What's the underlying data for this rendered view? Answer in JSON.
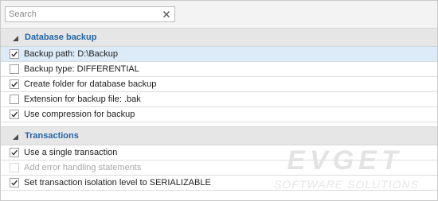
{
  "search": {
    "placeholder": "Search",
    "value": "",
    "clear_icon": "close-icon"
  },
  "groups": [
    {
      "title": "Database backup",
      "expanded": true,
      "items": [
        {
          "label": "Backup path: D:\\Backup",
          "checked": true,
          "enabled": true,
          "selected": true
        },
        {
          "label": "Backup type: DIFFERENTIAL",
          "checked": false,
          "enabled": true,
          "selected": false
        },
        {
          "label": "Create folder for database backup",
          "checked": true,
          "enabled": true,
          "selected": false
        },
        {
          "label": "Extension for backup file: .bak",
          "checked": false,
          "enabled": true,
          "selected": false
        },
        {
          "label": "Use compression for backup",
          "checked": true,
          "enabled": true,
          "selected": false
        }
      ]
    },
    {
      "title": "Transactions",
      "expanded": true,
      "items": [
        {
          "label": "Use a single transaction",
          "checked": true,
          "enabled": true,
          "selected": false
        },
        {
          "label": "Add error handling statements",
          "checked": false,
          "enabled": false,
          "selected": false
        },
        {
          "label": "Set transaction isolation level to SERIALIZABLE",
          "checked": true,
          "enabled": true,
          "selected": false
        }
      ]
    }
  ],
  "watermark": {
    "brand": "EVGET",
    "tagline": "SOFTWARE SOLUTIONS"
  },
  "colors": {
    "group_title": "#2365a8",
    "group_header_bg": "#e6e6e6",
    "selected_row_bg": "#ddeaf8",
    "disabled_text": "#a8a8a8"
  }
}
